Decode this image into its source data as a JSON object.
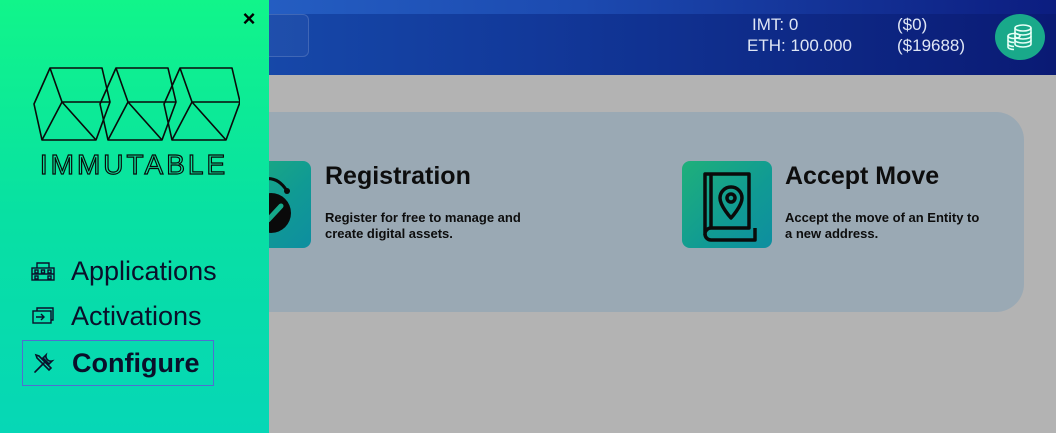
{
  "header": {
    "imt_label": "IMT: 0",
    "imt_usd": "($0)",
    "eth_label": "ETH: 100.000",
    "eth_usd": "($19688)"
  },
  "cards": [
    {
      "title": "Registration",
      "desc": "Register for free to manage and create digital assets.",
      "icon": "registration-check-icon"
    },
    {
      "title": "Accept Move",
      "desc": "Accept the move of an Entity to a new address.",
      "icon": "book-location-icon"
    }
  ],
  "sidebar": {
    "close_label": "×",
    "logo_text": "IMMUTABLE",
    "items": [
      {
        "label": "Applications",
        "icon": "applications-icon"
      },
      {
        "label": "Activations",
        "icon": "activations-icon"
      },
      {
        "label": "Configure",
        "icon": "tools-icon",
        "active": true
      }
    ]
  },
  "colors": {
    "sidebar_top": "#11f58a",
    "sidebar_bottom": "#06d7b6",
    "header_left": "#1a57b8",
    "header_right": "#0a1a74",
    "card_bg": "#9aa9b4",
    "wallet_btn": "#19a98a"
  }
}
